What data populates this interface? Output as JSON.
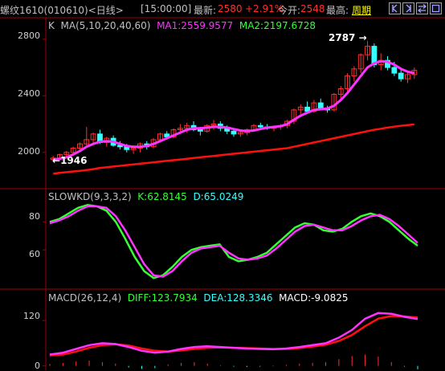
{
  "header": {
    "instrument": "螺纹1610(010610)<日线>",
    "time": "[15:00:00]",
    "latest_label": "最新:",
    "latest_value": "2580",
    "change": "+2.91%",
    "open_label": "今开:",
    "open_value": "2548",
    "high_label": "最高:",
    "cycle_button": "周期",
    "colors": {
      "up": "#ff3030",
      "label": "#c0c0c0",
      "bg": "#000000",
      "cycle": "#ffff00"
    }
  },
  "window_buttons": [
    "expand-left-icon",
    "expand-right-icon",
    "switch-view-icon",
    "restore-icon"
  ],
  "kline_panel": {
    "label": "K",
    "ma_label": "MA(5,10,20,40,60)",
    "ma1": "MA1:2559.9577",
    "ma2": "MA2:2197.6728",
    "y_ticks": [
      "2800",
      "2400",
      "2000"
    ],
    "high_annotation": "2787",
    "low_annotation": "1946",
    "y_range": [
      1800,
      2850
    ]
  },
  "kd_panel": {
    "label": "SLOWKD(9,3,3,2)",
    "k": "K:62.8145",
    "d": "D:65.0249",
    "y_ticks": [
      "80",
      "60"
    ],
    "y_range": [
      35,
      95
    ]
  },
  "macd_panel": {
    "label": "MACD(26,12,4)",
    "diff": "DIFF:123.7934",
    "dea": "DEA:128.3346",
    "macd": "MACD:-9.0825",
    "y_ticks": [
      "120",
      "0"
    ],
    "y_range": [
      -5,
      165
    ]
  },
  "chart_data": {
    "type": "line",
    "ohlc": [
      [
        1950,
        1975,
        1940,
        1960
      ],
      [
        1960,
        1990,
        1946,
        1985
      ],
      [
        1985,
        2010,
        1960,
        2000
      ],
      [
        2000,
        2040,
        1980,
        2030
      ],
      [
        2030,
        2070,
        2010,
        2060
      ],
      [
        2060,
        2180,
        2030,
        2090
      ],
      [
        2090,
        2140,
        2060,
        2130
      ],
      [
        2130,
        2160,
        2060,
        2070
      ],
      [
        2070,
        2110,
        2040,
        2100
      ],
      [
        2100,
        2120,
        2040,
        2050
      ],
      [
        2050,
        2080,
        2020,
        2040
      ],
      [
        2040,
        2060,
        2000,
        2020
      ],
      [
        2020,
        2050,
        1990,
        2030
      ],
      [
        2030,
        2070,
        2000,
        2060
      ],
      [
        2060,
        2080,
        2020,
        2040
      ],
      [
        2040,
        2100,
        2030,
        2090
      ],
      [
        2090,
        2140,
        2070,
        2130
      ],
      [
        2130,
        2150,
        2090,
        2110
      ],
      [
        2110,
        2170,
        2100,
        2160
      ],
      [
        2160,
        2200,
        2130,
        2170
      ],
      [
        2170,
        2210,
        2140,
        2190
      ],
      [
        2190,
        2220,
        2150,
        2160
      ],
      [
        2160,
        2180,
        2120,
        2150
      ],
      [
        2150,
        2200,
        2140,
        2190
      ],
      [
        2190,
        2230,
        2160,
        2200
      ],
      [
        2200,
        2220,
        2150,
        2170
      ],
      [
        2170,
        2190,
        2130,
        2150
      ],
      [
        2150,
        2170,
        2110,
        2130
      ],
      [
        2130,
        2150,
        2110,
        2140
      ],
      [
        2140,
        2170,
        2120,
        2160
      ],
      [
        2160,
        2200,
        2150,
        2190
      ],
      [
        2190,
        2210,
        2170,
        2180
      ],
      [
        2180,
        2200,
        2160,
        2170
      ],
      [
        2170,
        2190,
        2150,
        2180
      ],
      [
        2180,
        2200,
        2160,
        2190
      ],
      [
        2190,
        2230,
        2170,
        2220
      ],
      [
        2220,
        2310,
        2200,
        2300
      ],
      [
        2300,
        2340,
        2270,
        2320
      ],
      [
        2320,
        2360,
        2280,
        2290
      ],
      [
        2290,
        2370,
        2280,
        2350
      ],
      [
        2350,
        2380,
        2300,
        2310
      ],
      [
        2310,
        2330,
        2280,
        2300
      ],
      [
        2300,
        2420,
        2290,
        2410
      ],
      [
        2410,
        2470,
        2380,
        2450
      ],
      [
        2450,
        2560,
        2420,
        2540
      ],
      [
        2540,
        2610,
        2500,
        2590
      ],
      [
        2590,
        2700,
        2560,
        2690
      ],
      [
        2690,
        2787,
        2650,
        2750
      ],
      [
        2750,
        2770,
        2600,
        2620
      ],
      [
        2620,
        2700,
        2580,
        2650
      ],
      [
        2650,
        2680,
        2580,
        2600
      ],
      [
        2600,
        2640,
        2540,
        2560
      ],
      [
        2560,
        2600,
        2500,
        2520
      ],
      [
        2520,
        2570,
        2490,
        2550
      ],
      [
        2550,
        2600,
        2520,
        2580
      ]
    ],
    "ma1": [
      1950,
      1955,
      1965,
      1985,
      2010,
      2040,
      2060,
      2075,
      2080,
      2075,
      2060,
      2045,
      2040,
      2040,
      2045,
      2060,
      2080,
      2100,
      2120,
      2140,
      2160,
      2170,
      2170,
      2175,
      2180,
      2180,
      2175,
      2165,
      2155,
      2150,
      2155,
      2165,
      2175,
      2180,
      2185,
      2200,
      2230,
      2260,
      2280,
      2300,
      2305,
      2310,
      2330,
      2370,
      2420,
      2480,
      2540,
      2600,
      2630,
      2645,
      2640,
      2620,
      2590,
      2570,
      2560
    ],
    "ma2": [
      1850,
      1855,
      1860,
      1865,
      1870,
      1875,
      1882,
      1890,
      1895,
      1900,
      1905,
      1910,
      1915,
      1920,
      1925,
      1930,
      1935,
      1940,
      1945,
      1950,
      1955,
      1960,
      1965,
      1970,
      1975,
      1980,
      1985,
      1990,
      1995,
      2000,
      2005,
      2010,
      2015,
      2020,
      2025,
      2030,
      2040,
      2050,
      2060,
      2070,
      2080,
      2090,
      2100,
      2110,
      2120,
      2130,
      2140,
      2150,
      2160,
      2167,
      2175,
      2182,
      2188,
      2193,
      2198
    ],
    "kd_k": [
      80,
      82,
      86,
      90,
      92,
      91,
      88,
      80,
      68,
      55,
      45,
      40,
      42,
      48,
      55,
      60,
      62,
      63,
      64,
      55,
      52,
      53,
      55,
      58,
      64,
      70,
      76,
      79,
      78,
      74,
      73,
      75,
      80,
      84,
      86,
      84,
      80,
      74,
      68,
      63
    ],
    "kd_d": [
      79,
      81,
      84,
      88,
      91,
      91,
      90,
      84,
      74,
      62,
      50,
      42,
      41,
      45,
      52,
      58,
      61,
      62,
      63,
      58,
      54,
      53,
      54,
      56,
      61,
      67,
      73,
      77,
      78,
      76,
      74,
      74,
      77,
      81,
      84,
      85,
      82,
      77,
      71,
      65
    ],
    "macd_diff": [
      30,
      35,
      45,
      55,
      60,
      58,
      50,
      40,
      35,
      38,
      45,
      50,
      52,
      50,
      48,
      46,
      45,
      44,
      46,
      50,
      55,
      60,
      75,
      95,
      125,
      140,
      138,
      130,
      124
    ],
    "macd_dea": [
      28,
      30,
      38,
      48,
      55,
      57,
      54,
      46,
      40,
      38,
      41,
      45,
      48,
      49,
      48,
      47,
      46,
      45,
      45,
      47,
      51,
      56,
      66,
      82,
      105,
      125,
      132,
      131,
      128
    ],
    "macd_hist": [
      5,
      8,
      12,
      14,
      10,
      6,
      -4,
      -8,
      -6,
      4,
      8,
      10,
      6,
      2,
      -2,
      -3,
      -2,
      -1,
      3,
      6,
      8,
      10,
      18,
      26,
      30,
      25,
      10,
      -2,
      -9
    ]
  }
}
